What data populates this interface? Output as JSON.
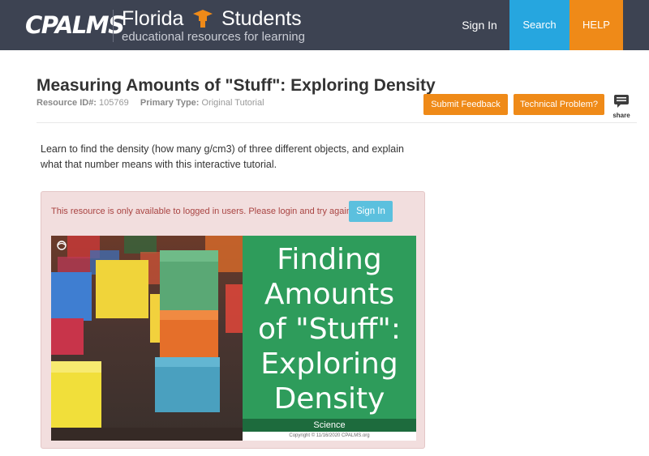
{
  "header": {
    "logo_text": "CPALMS",
    "brand_florida": "Florida",
    "brand_students": "Students",
    "tagline": "educational resources for learning",
    "graduation_icon": "graduation-cap-icon",
    "nav": {
      "sign_in": "Sign In",
      "search": "Search",
      "help": "HELP"
    },
    "colors": {
      "bar": "#3d4352",
      "search": "#26a6df",
      "help": "#ef8a18"
    }
  },
  "resource": {
    "title": "Measuring Amounts of \"Stuff\": Exploring Density",
    "id_label": "Resource ID#:",
    "id_value": "105769",
    "type_label": "Primary Type:",
    "type_value": "Original Tutorial",
    "submit_feedback": "Submit Feedback",
    "technical_problem": "Technical Problem?",
    "share_label": "share",
    "share_icon": "share-speech-icon",
    "description": "Learn to find the density (how many g/cm3) of three different objects, and explain what that number means with this interactive tutorial."
  },
  "alert": {
    "message": "This resource is only available to logged in users. Please login and try again.",
    "sign_in": "Sign In",
    "colors": {
      "bg": "#f2dede",
      "text": "#a94442",
      "button": "#5bc0de"
    }
  },
  "thumbnail": {
    "title_lines": [
      "Finding",
      "Amounts",
      "of \"Stuff\":",
      "Exploring",
      "Density"
    ],
    "subject": "Science",
    "copyright": "Copyright © 11/16/2020 CPALMS.org",
    "colors": {
      "panel": "#2e9c5b",
      "subject_bar": "#1d6b3d"
    }
  }
}
